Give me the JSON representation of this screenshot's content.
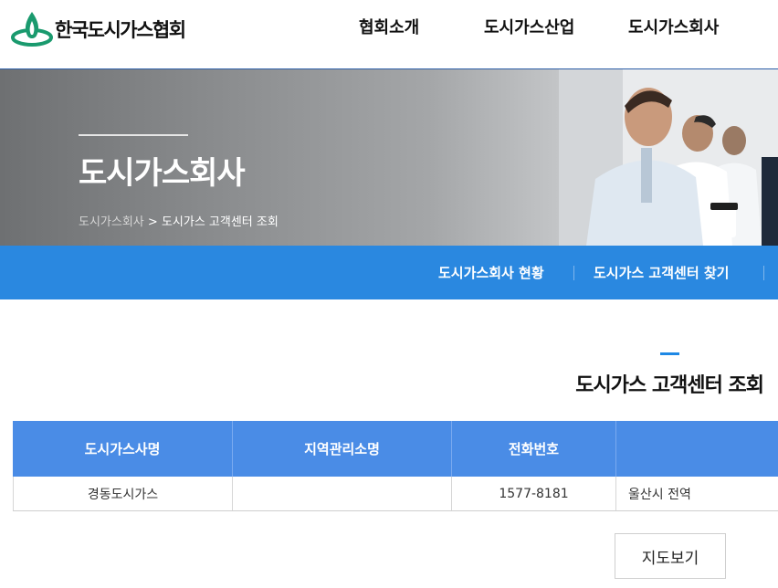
{
  "header": {
    "logo_text": "한국도시가스협회",
    "nav": [
      "협회소개",
      "도시가스산업",
      "도시가스회사"
    ]
  },
  "hero": {
    "title": "도시가스회사",
    "breadcrumb": [
      "도시가스회사",
      "도시가스 고객센터 조회"
    ],
    "breadcrumb_sep": ">"
  },
  "subnav": {
    "items": [
      "도시가스회사 현황",
      "도시가스 고객센터 찾기"
    ]
  },
  "section": {
    "title": "도시가스 고객센터 조회"
  },
  "table": {
    "headers": [
      "도시가스사명",
      "지역관리소명",
      "전화번호",
      ""
    ],
    "rows": [
      [
        "경동도시가스",
        "",
        "1577-8181",
        "울산시 전역"
      ]
    ]
  },
  "map_button": "지도보기",
  "colors": {
    "brand_blue": "#2a88e0",
    "table_header": "#4a8ce6",
    "logo_green": "#1a9a6e"
  }
}
